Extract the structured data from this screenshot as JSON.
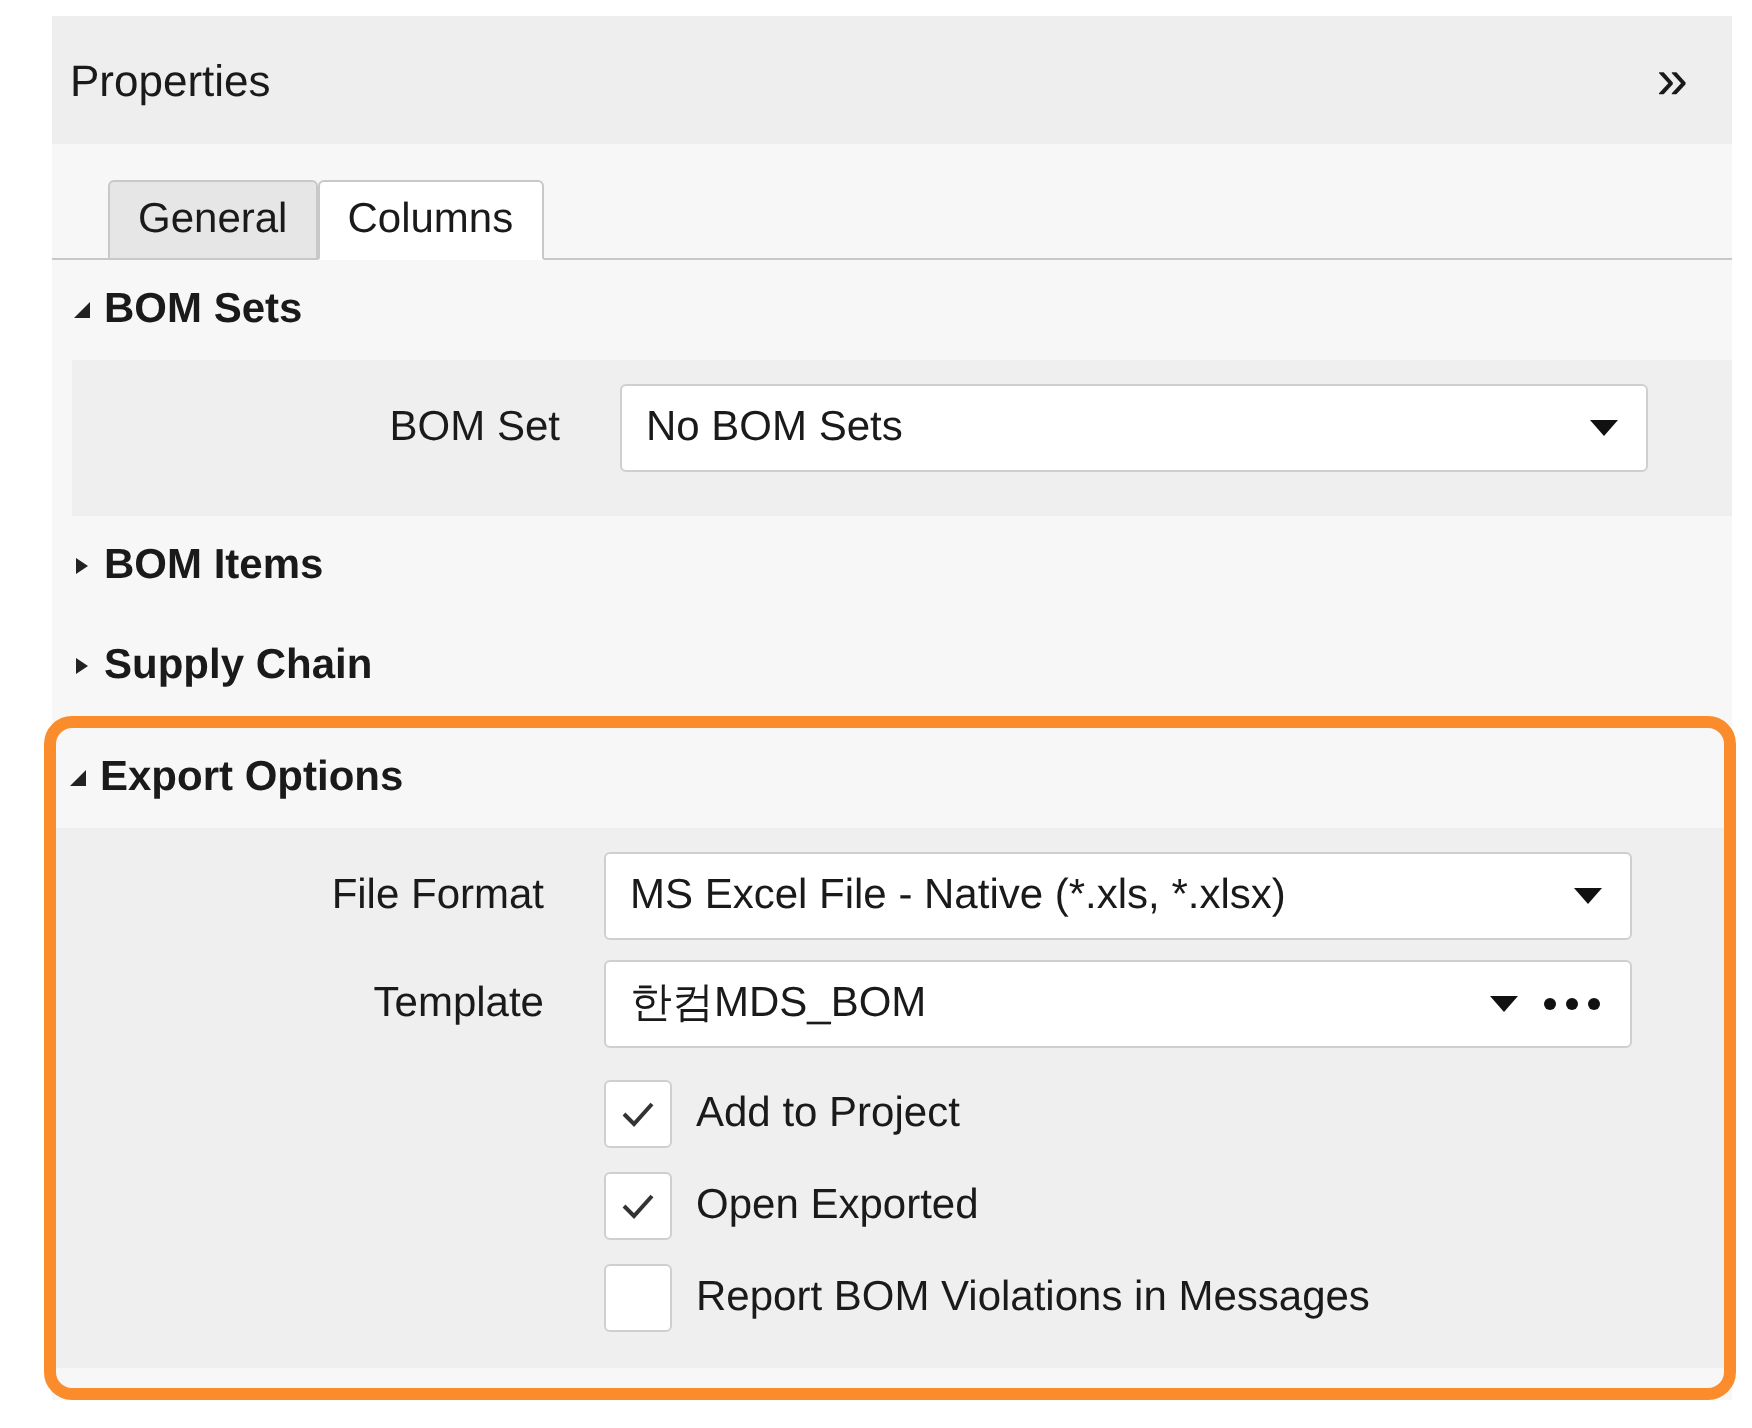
{
  "panel": {
    "title": "Properties",
    "collapse_glyph": "»"
  },
  "tabs": [
    {
      "label": "General",
      "selected": false
    },
    {
      "label": "Columns",
      "selected": true
    }
  ],
  "sections": [
    {
      "title": "BOM Sets",
      "expanded": true,
      "highlighted": false,
      "fields": [
        {
          "kind": "dropdown",
          "label": "BOM Set",
          "value": "No BOM Sets"
        }
      ]
    },
    {
      "title": "BOM Items",
      "expanded": false,
      "highlighted": false
    },
    {
      "title": "Supply Chain",
      "expanded": false,
      "highlighted": false
    },
    {
      "title": "Export Options",
      "expanded": true,
      "highlighted": true,
      "fields": [
        {
          "kind": "dropdown",
          "label": "File Format",
          "value": "MS Excel File - Native (*.xls, *.xlsx)"
        },
        {
          "kind": "dropdown_more",
          "label": "Template",
          "value": "한컴MDS_BOM"
        },
        {
          "kind": "checkbox",
          "label": "Add to Project",
          "checked": true
        },
        {
          "kind": "checkbox",
          "label": "Open Exported",
          "checked": true
        },
        {
          "kind": "checkbox",
          "label": "Report BOM Violations in Messages",
          "checked": false
        }
      ]
    }
  ]
}
